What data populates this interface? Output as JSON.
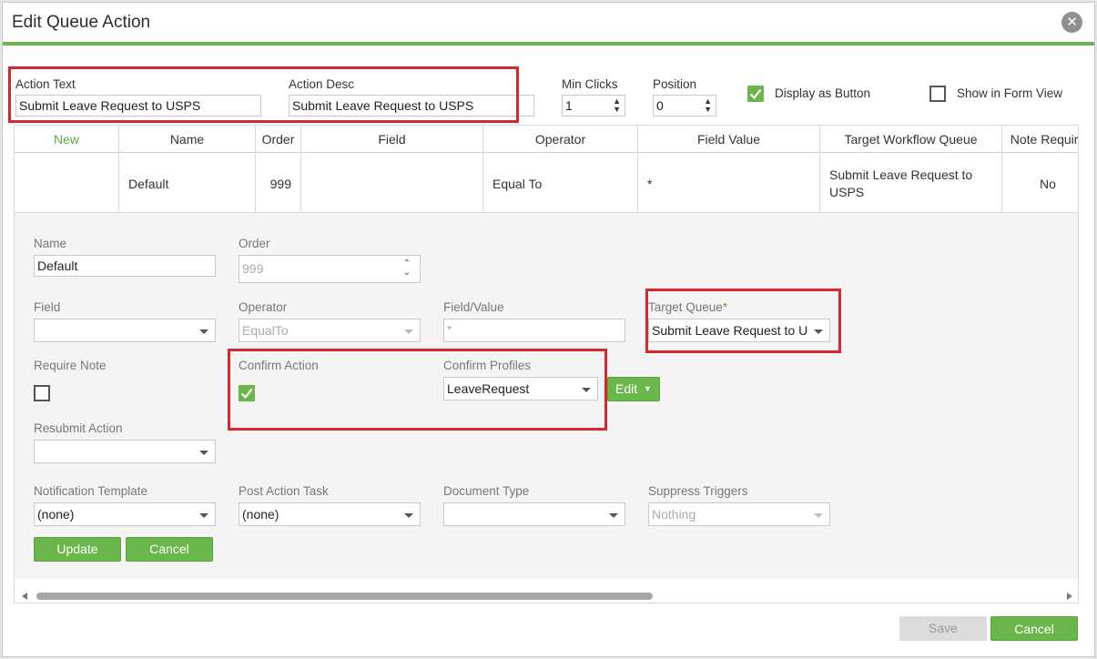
{
  "dialog": {
    "title": "Edit Queue Action",
    "close_icon": "close-icon"
  },
  "top_form": {
    "action_text_label": "Action Text",
    "action_text_value": "Submit Leave Request to USPS",
    "action_desc_label": "Action Desc",
    "action_desc_value": "Submit Leave Request to USPS",
    "min_clicks_label": "Min Clicks",
    "min_clicks_value": "1",
    "position_label": "Position",
    "position_value": "0",
    "display_as_button_label": "Display as Button",
    "display_as_button_checked": true,
    "show_in_form_view_label": "Show in Form View",
    "show_in_form_view_checked": false
  },
  "grid": {
    "columns": [
      "New",
      "Name",
      "Order",
      "Field",
      "Operator",
      "Field Value",
      "Target Workflow Queue",
      "Note Require"
    ],
    "row": {
      "name": "Default",
      "order": "999",
      "field": "",
      "operator": "Equal To",
      "field_value": "*",
      "target_queue": "Submit Leave Request to USPS",
      "note_required": "No"
    }
  },
  "edit_form": {
    "name_label": "Name",
    "name_value": "Default",
    "order_label": "Order",
    "order_value": "999",
    "field_label": "Field",
    "field_value": "",
    "operator_label": "Operator",
    "operator_value": "EqualTo",
    "field_value_label": "Field/Value",
    "field_value_placeholder": "*",
    "target_queue_label": "Target Queue",
    "target_queue_required": "*",
    "target_queue_value": "Submit Leave Request to US",
    "require_note_label": "Require Note",
    "require_note_checked": false,
    "confirm_action_label": "Confirm Action",
    "confirm_action_checked": true,
    "confirm_profiles_label": "Confirm Profiles",
    "confirm_profiles_value": "LeaveRequest",
    "edit_button_label": "Edit",
    "resubmit_action_label": "Resubmit Action",
    "resubmit_action_value": "",
    "notification_template_label": "Notification Template",
    "notification_template_value": "(none)",
    "post_action_task_label": "Post Action Task",
    "post_action_task_value": "(none)",
    "document_type_label": "Document Type",
    "document_type_value": "",
    "suppress_triggers_label": "Suppress Triggers",
    "suppress_triggers_value": "Nothing",
    "update_button_label": "Update",
    "cancel_button_label": "Cancel"
  },
  "footer": {
    "save_label": "Save",
    "cancel_label": "Cancel"
  },
  "colors": {
    "accent_green": "#6ab64b",
    "highlight_red": "#d9262c"
  }
}
